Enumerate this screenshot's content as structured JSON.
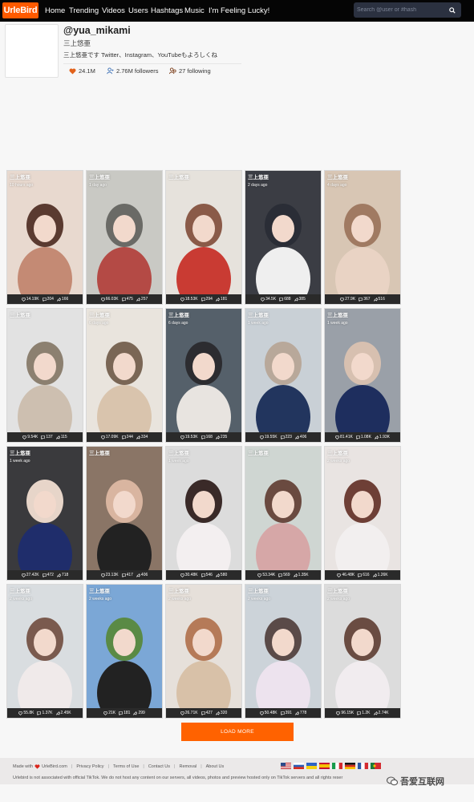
{
  "nav": {
    "logo": "UrleBird",
    "links": [
      "Home",
      "Trending",
      "Videos",
      "Users",
      "Hashtags",
      "Music",
      "I'm Feeling Lucky!"
    ],
    "search_placeholder": "Search @user or #hash"
  },
  "profile": {
    "username": "@yua_mikami",
    "nickname": "三上悠亜",
    "bio": "三上悠亜です Twitter、Instagram、YouTubeもよろしくね",
    "likes": "24.1M",
    "followers": "2.76M followers",
    "following": "27 following"
  },
  "videos": [
    {
      "name": "三上悠亜",
      "time": "10 hours ago",
      "likes": "14.19K",
      "comments": "204",
      "shares": "166"
    },
    {
      "name": "三上悠亜",
      "time": "1 day ago",
      "likes": "66.03K",
      "comments": "475",
      "shares": "257"
    },
    {
      "name": "三上悠亜",
      "time": "",
      "likes": "18.53K",
      "comments": "294",
      "shares": "181"
    },
    {
      "name": "三上悠亜",
      "time": "2 days ago",
      "likes": "34.5K",
      "comments": "688",
      "shares": "385"
    },
    {
      "name": "三上悠亜",
      "time": "4 days ago",
      "likes": "27.9K",
      "comments": "367",
      "shares": "516"
    },
    {
      "name": "三上悠亜",
      "time": "",
      "likes": "9.54K",
      "comments": "137",
      "shares": "115"
    },
    {
      "name": "三上悠亜",
      "time": "6 days ago",
      "likes": "17.09K",
      "comments": "244",
      "shares": "334"
    },
    {
      "name": "三上悠亜",
      "time": "6 days ago",
      "likes": "19.53K",
      "comments": "168",
      "shares": "235"
    },
    {
      "name": "三上悠亜",
      "time": "1 week ago",
      "likes": "19.55K",
      "comments": "223",
      "shares": "406"
    },
    {
      "name": "三上悠亜",
      "time": "1 week ago",
      "likes": "81.41K",
      "comments": "1.08K",
      "shares": "1.93K"
    },
    {
      "name": "三上悠亜",
      "time": "1 week ago",
      "likes": "27.42K",
      "comments": "472",
      "shares": "718"
    },
    {
      "name": "三上悠亜",
      "time": "",
      "likes": "23.13K",
      "comments": "417",
      "shares": "406"
    },
    {
      "name": "三上悠亜",
      "time": "1 week ago",
      "likes": "30.48K",
      "comments": "546",
      "shares": "580"
    },
    {
      "name": "三上悠亜",
      "time": "",
      "likes": "53.34K",
      "comments": "569",
      "shares": "1.35K"
    },
    {
      "name": "三上悠亜",
      "time": "2 weeks ago",
      "likes": "46.48K",
      "comments": "616",
      "shares": "1.26K"
    },
    {
      "name": "三上悠亜",
      "time": "2 weeks ago",
      "likes": "55.8K",
      "comments": "1.37K",
      "shares": "2.45K"
    },
    {
      "name": "三上悠亜",
      "time": "2 weeks ago",
      "likes": "21K",
      "comments": "181",
      "shares": "299"
    },
    {
      "name": "三上悠亜",
      "time": "2 weeks ago",
      "likes": "26.71K",
      "comments": "427",
      "shares": "320"
    },
    {
      "name": "三上悠亜",
      "time": "2 weeks ago",
      "likes": "50.48K",
      "comments": "391",
      "shares": "778"
    },
    {
      "name": "三上悠亜",
      "time": "2 weeks ago",
      "likes": "96.15K",
      "comments": "1.2K",
      "shares": "2.74K"
    }
  ],
  "load_more": "LOAD MORE",
  "footer": {
    "made_with": "Made with",
    "site": "UrleBird.com",
    "links": [
      "Privacy Policy",
      "Terms of Use",
      "Contact Us",
      "Removal",
      "About Us"
    ],
    "note": "Urlebird is not associated with official TikTok. We do not host any content on our servers, all videos, photos and preview hosted only on TikTok servers and all rights reser"
  },
  "watermark": "吾爱互联网",
  "colors": {
    "accent": "#ff6200",
    "navbar": "#050505",
    "heart": "#d9261c"
  }
}
